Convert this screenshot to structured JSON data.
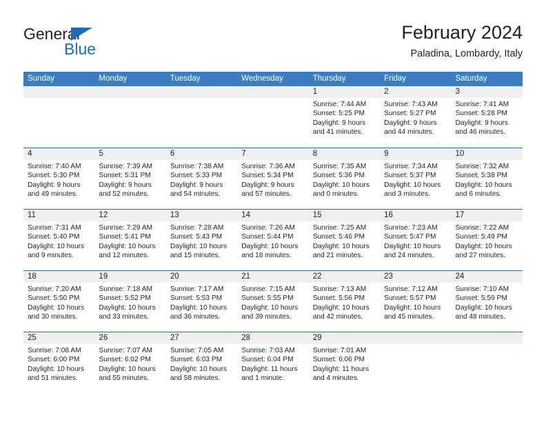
{
  "brand": {
    "name_part1": "General",
    "name_part2": "Blue",
    "accent_color": "#1f6cb4"
  },
  "header": {
    "title": "February 2024",
    "subtitle": "Paladina, Lombardy, Italy"
  },
  "calendar": {
    "header_bg": "#3a7ebf",
    "day_band_bg": "#f0f0f0",
    "weekdays": [
      "Sunday",
      "Monday",
      "Tuesday",
      "Wednesday",
      "Thursday",
      "Friday",
      "Saturday"
    ],
    "weeks": [
      [
        {
          "day": "",
          "blank": true,
          "sunrise": "",
          "sunset": "",
          "daylight1": "",
          "daylight2": ""
        },
        {
          "day": "",
          "blank": true,
          "sunrise": "",
          "sunset": "",
          "daylight1": "",
          "daylight2": ""
        },
        {
          "day": "",
          "blank": true,
          "sunrise": "",
          "sunset": "",
          "daylight1": "",
          "daylight2": ""
        },
        {
          "day": "",
          "blank": true,
          "sunrise": "",
          "sunset": "",
          "daylight1": "",
          "daylight2": ""
        },
        {
          "day": "1",
          "blank": false,
          "sunrise": "Sunrise: 7:44 AM",
          "sunset": "Sunset: 5:25 PM",
          "daylight1": "Daylight: 9 hours",
          "daylight2": "and 41 minutes."
        },
        {
          "day": "2",
          "blank": false,
          "sunrise": "Sunrise: 7:43 AM",
          "sunset": "Sunset: 5:27 PM",
          "daylight1": "Daylight: 9 hours",
          "daylight2": "and 44 minutes."
        },
        {
          "day": "3",
          "blank": false,
          "sunrise": "Sunrise: 7:41 AM",
          "sunset": "Sunset: 5:28 PM",
          "daylight1": "Daylight: 9 hours",
          "daylight2": "and 46 minutes."
        }
      ],
      [
        {
          "day": "4",
          "blank": false,
          "sunrise": "Sunrise: 7:40 AM",
          "sunset": "Sunset: 5:30 PM",
          "daylight1": "Daylight: 9 hours",
          "daylight2": "and 49 minutes."
        },
        {
          "day": "5",
          "blank": false,
          "sunrise": "Sunrise: 7:39 AM",
          "sunset": "Sunset: 5:31 PM",
          "daylight1": "Daylight: 9 hours",
          "daylight2": "and 52 minutes."
        },
        {
          "day": "6",
          "blank": false,
          "sunrise": "Sunrise: 7:38 AM",
          "sunset": "Sunset: 5:33 PM",
          "daylight1": "Daylight: 9 hours",
          "daylight2": "and 54 minutes."
        },
        {
          "day": "7",
          "blank": false,
          "sunrise": "Sunrise: 7:36 AM",
          "sunset": "Sunset: 5:34 PM",
          "daylight1": "Daylight: 9 hours",
          "daylight2": "and 57 minutes."
        },
        {
          "day": "8",
          "blank": false,
          "sunrise": "Sunrise: 7:35 AM",
          "sunset": "Sunset: 5:36 PM",
          "daylight1": "Daylight: 10 hours",
          "daylight2": "and 0 minutes."
        },
        {
          "day": "9",
          "blank": false,
          "sunrise": "Sunrise: 7:34 AM",
          "sunset": "Sunset: 5:37 PM",
          "daylight1": "Daylight: 10 hours",
          "daylight2": "and 3 minutes."
        },
        {
          "day": "10",
          "blank": false,
          "sunrise": "Sunrise: 7:32 AM",
          "sunset": "Sunset: 5:38 PM",
          "daylight1": "Daylight: 10 hours",
          "daylight2": "and 6 minutes."
        }
      ],
      [
        {
          "day": "11",
          "blank": false,
          "sunrise": "Sunrise: 7:31 AM",
          "sunset": "Sunset: 5:40 PM",
          "daylight1": "Daylight: 10 hours",
          "daylight2": "and 9 minutes."
        },
        {
          "day": "12",
          "blank": false,
          "sunrise": "Sunrise: 7:29 AM",
          "sunset": "Sunset: 5:41 PM",
          "daylight1": "Daylight: 10 hours",
          "daylight2": "and 12 minutes."
        },
        {
          "day": "13",
          "blank": false,
          "sunrise": "Sunrise: 7:28 AM",
          "sunset": "Sunset: 5:43 PM",
          "daylight1": "Daylight: 10 hours",
          "daylight2": "and 15 minutes."
        },
        {
          "day": "14",
          "blank": false,
          "sunrise": "Sunrise: 7:26 AM",
          "sunset": "Sunset: 5:44 PM",
          "daylight1": "Daylight: 10 hours",
          "daylight2": "and 18 minutes."
        },
        {
          "day": "15",
          "blank": false,
          "sunrise": "Sunrise: 7:25 AM",
          "sunset": "Sunset: 5:46 PM",
          "daylight1": "Daylight: 10 hours",
          "daylight2": "and 21 minutes."
        },
        {
          "day": "16",
          "blank": false,
          "sunrise": "Sunrise: 7:23 AM",
          "sunset": "Sunset: 5:47 PM",
          "daylight1": "Daylight: 10 hours",
          "daylight2": "and 24 minutes."
        },
        {
          "day": "17",
          "blank": false,
          "sunrise": "Sunrise: 7:22 AM",
          "sunset": "Sunset: 5:49 PM",
          "daylight1": "Daylight: 10 hours",
          "daylight2": "and 27 minutes."
        }
      ],
      [
        {
          "day": "18",
          "blank": false,
          "sunrise": "Sunrise: 7:20 AM",
          "sunset": "Sunset: 5:50 PM",
          "daylight1": "Daylight: 10 hours",
          "daylight2": "and 30 minutes."
        },
        {
          "day": "19",
          "blank": false,
          "sunrise": "Sunrise: 7:18 AM",
          "sunset": "Sunset: 5:52 PM",
          "daylight1": "Daylight: 10 hours",
          "daylight2": "and 33 minutes."
        },
        {
          "day": "20",
          "blank": false,
          "sunrise": "Sunrise: 7:17 AM",
          "sunset": "Sunset: 5:53 PM",
          "daylight1": "Daylight: 10 hours",
          "daylight2": "and 36 minutes."
        },
        {
          "day": "21",
          "blank": false,
          "sunrise": "Sunrise: 7:15 AM",
          "sunset": "Sunset: 5:55 PM",
          "daylight1": "Daylight: 10 hours",
          "daylight2": "and 39 minutes."
        },
        {
          "day": "22",
          "blank": false,
          "sunrise": "Sunrise: 7:13 AM",
          "sunset": "Sunset: 5:56 PM",
          "daylight1": "Daylight: 10 hours",
          "daylight2": "and 42 minutes."
        },
        {
          "day": "23",
          "blank": false,
          "sunrise": "Sunrise: 7:12 AM",
          "sunset": "Sunset: 5:57 PM",
          "daylight1": "Daylight: 10 hours",
          "daylight2": "and 45 minutes."
        },
        {
          "day": "24",
          "blank": false,
          "sunrise": "Sunrise: 7:10 AM",
          "sunset": "Sunset: 5:59 PM",
          "daylight1": "Daylight: 10 hours",
          "daylight2": "and 48 minutes."
        }
      ],
      [
        {
          "day": "25",
          "blank": false,
          "sunrise": "Sunrise: 7:08 AM",
          "sunset": "Sunset: 6:00 PM",
          "daylight1": "Daylight: 10 hours",
          "daylight2": "and 51 minutes."
        },
        {
          "day": "26",
          "blank": false,
          "sunrise": "Sunrise: 7:07 AM",
          "sunset": "Sunset: 6:02 PM",
          "daylight1": "Daylight: 10 hours",
          "daylight2": "and 55 minutes."
        },
        {
          "day": "27",
          "blank": false,
          "sunrise": "Sunrise: 7:05 AM",
          "sunset": "Sunset: 6:03 PM",
          "daylight1": "Daylight: 10 hours",
          "daylight2": "and 58 minutes."
        },
        {
          "day": "28",
          "blank": false,
          "sunrise": "Sunrise: 7:03 AM",
          "sunset": "Sunset: 6:04 PM",
          "daylight1": "Daylight: 11 hours",
          "daylight2": "and 1 minute."
        },
        {
          "day": "29",
          "blank": false,
          "sunrise": "Sunrise: 7:01 AM",
          "sunset": "Sunset: 6:06 PM",
          "daylight1": "Daylight: 11 hours",
          "daylight2": "and 4 minutes."
        },
        {
          "day": "",
          "blank": true,
          "sunrise": "",
          "sunset": "",
          "daylight1": "",
          "daylight2": ""
        },
        {
          "day": "",
          "blank": true,
          "sunrise": "",
          "sunset": "",
          "daylight1": "",
          "daylight2": ""
        }
      ]
    ]
  }
}
